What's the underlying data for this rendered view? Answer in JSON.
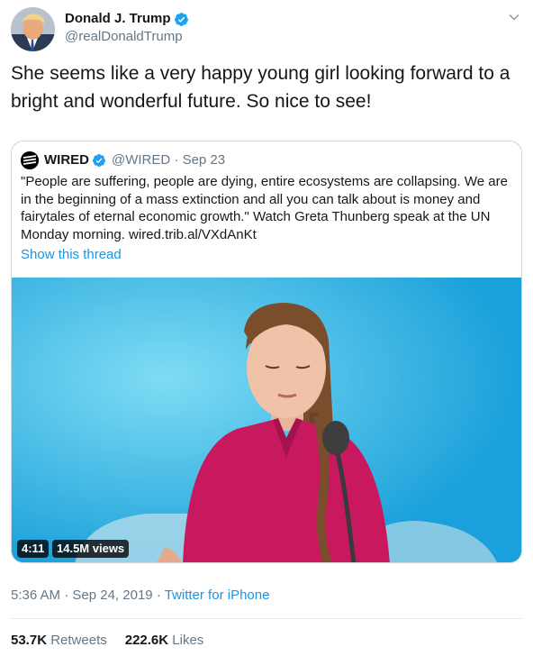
{
  "tweet": {
    "display_name": "Donald J. Trump",
    "handle": "@realDonaldTrump",
    "text": "She seems like a very happy young girl looking forward to a bright and wonderful future. So nice to see!",
    "time": "5:36 AM",
    "date": "Sep 24, 2019",
    "source": "Twitter for iPhone",
    "retweets_count": "53.7K",
    "retweets_label": "Retweets",
    "likes_count": "222.6K",
    "likes_label": "Likes"
  },
  "quote": {
    "display_name": "WIRED",
    "handle": "@WIRED",
    "date": "Sep 23",
    "text": "\"People are suffering, people are dying, entire ecosystems are collapsing. We are in the beginning of a mass extinction and all you can talk about is money and fairytales of eternal economic growth.\" Watch Greta Thunberg speak at the UN Monday morning. wired.trib.al/VXdAnKt",
    "show_thread": "Show this thread",
    "video_duration": "4:11",
    "video_views": "14.5M views"
  },
  "colors": {
    "link": "#1b95e0",
    "muted": "#657786",
    "verified": "#1da1f2",
    "video_bg": "#29b0e2",
    "shirt": "#c8185e"
  },
  "icons": [
    "verified-badge-icon",
    "chevron-down-icon",
    "wired-logo-icon"
  ]
}
